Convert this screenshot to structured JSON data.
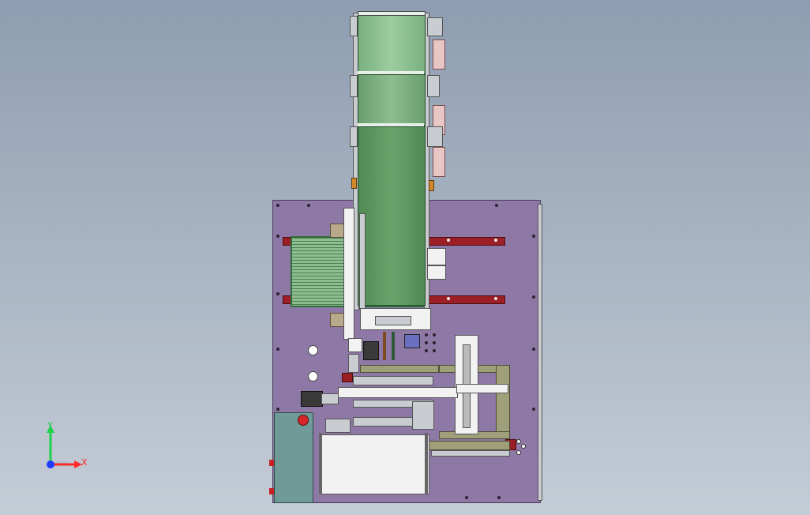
{
  "viewport": {
    "background_top": "#8e9db1",
    "background_bottom": "#c4ccd6"
  },
  "model": {
    "base_plate_color": "#8e78a6",
    "conveyor_color": "#5c965f",
    "rail_color": "#9c1f25",
    "control_box_color": "#6f9a98",
    "emergency_stop_color": "#d6262b"
  },
  "triad": {
    "x_label": "X",
    "y_label": "Y",
    "x_color": "#ff2a2a",
    "y_color": "#1fd04a",
    "z_color": "#1d3cff"
  }
}
